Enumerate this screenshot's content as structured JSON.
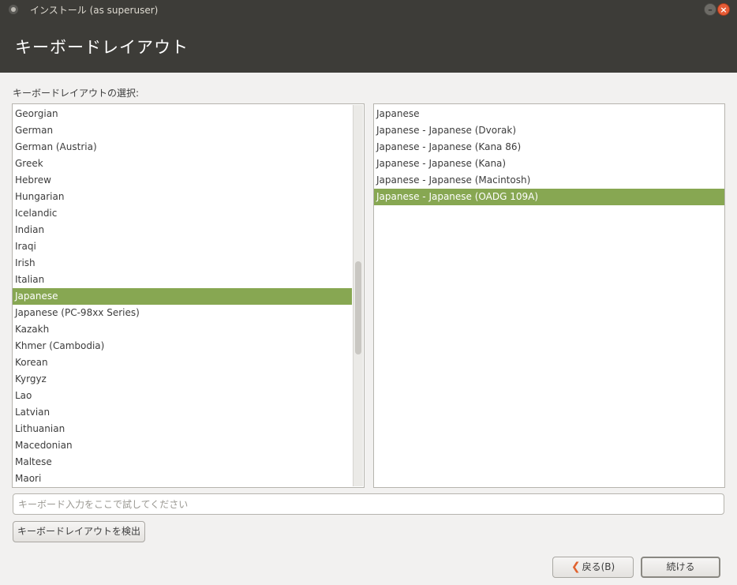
{
  "window": {
    "title": "インストール (as superuser)",
    "minimize_glyph": "–",
    "close_glyph": "×"
  },
  "header": {
    "title": "キーボードレイアウト"
  },
  "main": {
    "select_label": "キーボードレイアウトの選択:",
    "layouts": [
      {
        "label": "Georgian",
        "selected": false
      },
      {
        "label": "German",
        "selected": false
      },
      {
        "label": "German (Austria)",
        "selected": false
      },
      {
        "label": "Greek",
        "selected": false
      },
      {
        "label": "Hebrew",
        "selected": false
      },
      {
        "label": "Hungarian",
        "selected": false
      },
      {
        "label": "Icelandic",
        "selected": false
      },
      {
        "label": "Indian",
        "selected": false
      },
      {
        "label": "Iraqi",
        "selected": false
      },
      {
        "label": "Irish",
        "selected": false
      },
      {
        "label": "Italian",
        "selected": false
      },
      {
        "label": "Japanese",
        "selected": true
      },
      {
        "label": "Japanese (PC-98xx Series)",
        "selected": false
      },
      {
        "label": "Kazakh",
        "selected": false
      },
      {
        "label": "Khmer (Cambodia)",
        "selected": false
      },
      {
        "label": "Korean",
        "selected": false
      },
      {
        "label": "Kyrgyz",
        "selected": false
      },
      {
        "label": "Lao",
        "selected": false
      },
      {
        "label": "Latvian",
        "selected": false
      },
      {
        "label": "Lithuanian",
        "selected": false
      },
      {
        "label": "Macedonian",
        "selected": false
      },
      {
        "label": "Maltese",
        "selected": false
      },
      {
        "label": "Maori",
        "selected": false
      }
    ],
    "variants": [
      {
        "label": "Japanese",
        "selected": false
      },
      {
        "label": "Japanese - Japanese (Dvorak)",
        "selected": false
      },
      {
        "label": "Japanese - Japanese (Kana 86)",
        "selected": false
      },
      {
        "label": "Japanese - Japanese (Kana)",
        "selected": false
      },
      {
        "label": "Japanese - Japanese (Macintosh)",
        "selected": false
      },
      {
        "label": "Japanese - Japanese (OADG 109A)",
        "selected": true
      }
    ],
    "test_input": {
      "value": "",
      "placeholder": "キーボード入力をここで試してください"
    },
    "detect_button_label": "キーボードレイアウトを検出"
  },
  "footer": {
    "back_icon": "chevron-left-icon",
    "back_label": "戻る(B)",
    "continue_label": "続ける"
  },
  "colors": {
    "selection": "#87a752",
    "header_bg": "#3d3c38",
    "window_bg": "#f2f1f0",
    "close_button": "#e75c36",
    "back_arrow": "#e0622e"
  }
}
